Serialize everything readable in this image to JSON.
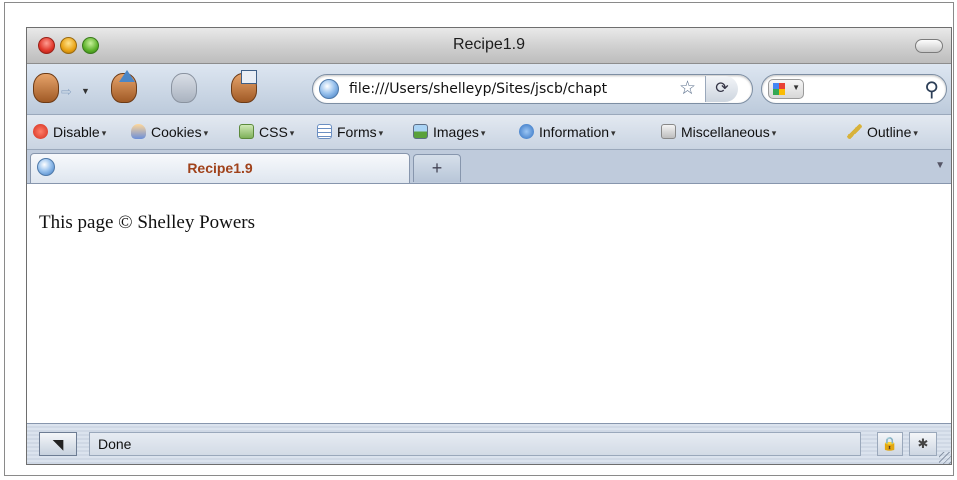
{
  "window": {
    "title": "Recipe1.9"
  },
  "navigation": {
    "url": "file:///Users/shelleyp/Sites/jscb/chapt",
    "bookmark_star": "☆",
    "go_glyph": "⟳",
    "search_glyph": "⚲"
  },
  "dev_toolbar": {
    "items": [
      {
        "label": "Disable",
        "icon": "disable-icon"
      },
      {
        "label": "Cookies",
        "icon": "cookies-icon"
      },
      {
        "label": "CSS",
        "icon": "css-icon"
      },
      {
        "label": "Forms",
        "icon": "forms-icon"
      },
      {
        "label": "Images",
        "icon": "images-icon"
      },
      {
        "label": "Information",
        "icon": "information-icon"
      },
      {
        "label": "Miscellaneous",
        "icon": "miscellaneous-icon"
      },
      {
        "label": "Outline",
        "icon": "outline-icon"
      }
    ],
    "dropdown_glyph": "▾"
  },
  "tabs": {
    "items": [
      {
        "label": "Recipe1.9"
      }
    ],
    "new_tab_label": "+",
    "list_glyph": "▼"
  },
  "content": {
    "text": "This page © Shelley Powers"
  },
  "status": {
    "text": "Done",
    "lock_glyph": "🔒",
    "bug_glyph": "✱"
  },
  "colors": {
    "tab_title": "#a0421b",
    "close_light": "#e0362a",
    "minimize_light": "#e9a214",
    "zoom_light": "#5cb12a"
  }
}
